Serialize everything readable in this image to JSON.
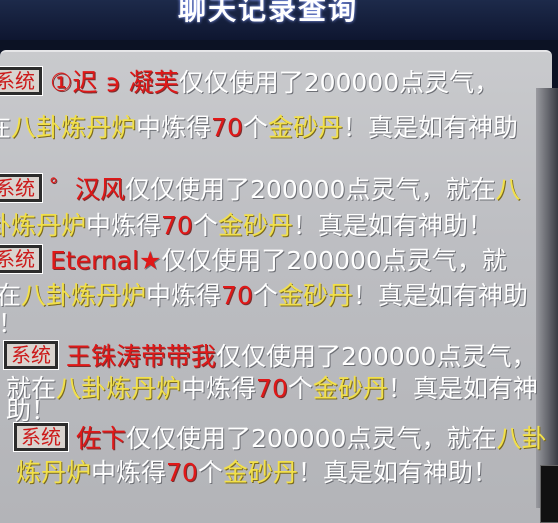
{
  "window": {
    "title": "聊天记录查询"
  },
  "badge_label": "系统",
  "messages": [
    {
      "name": "①迟 ϶ 凝芙",
      "lines": [
        "仅仅使用了200000点灵气，",
        "在",
        "八卦炼丹炉",
        "中炼得",
        "70",
        "个",
        "金砂丹",
        "！真是如有神助",
        "！"
      ]
    },
    {
      "name": "゜汉风",
      "lines": [
        "仅仅使用了200000点灵气，就在",
        "八",
        "卦炼丹炉",
        "中炼得",
        "70",
        "个",
        "金砂丹",
        "！真是如有神助！"
      ]
    },
    {
      "name": "Eternal",
      "star": "★",
      "lines": [
        "仅仅使用了200000点灵气，就",
        "在",
        "八卦炼丹炉",
        "中炼得",
        "70",
        "个",
        "金砂丹",
        "！真是如有神助",
        "！"
      ]
    },
    {
      "name": "王铢涛带带我",
      "lines": [
        "仅仅使用了200000点灵气，",
        "就在",
        "八卦炼丹炉",
        "中炼得",
        "70",
        "个",
        "金砂丹",
        "！真是如有神",
        "助！"
      ]
    },
    {
      "name": "佐卞",
      "lines": [
        "仅仅使用了200000点灵气，就在",
        "八卦",
        "炼丹炉",
        "中炼得",
        "70",
        "个",
        "金砂丹",
        "！真是如有神助！"
      ]
    }
  ]
}
